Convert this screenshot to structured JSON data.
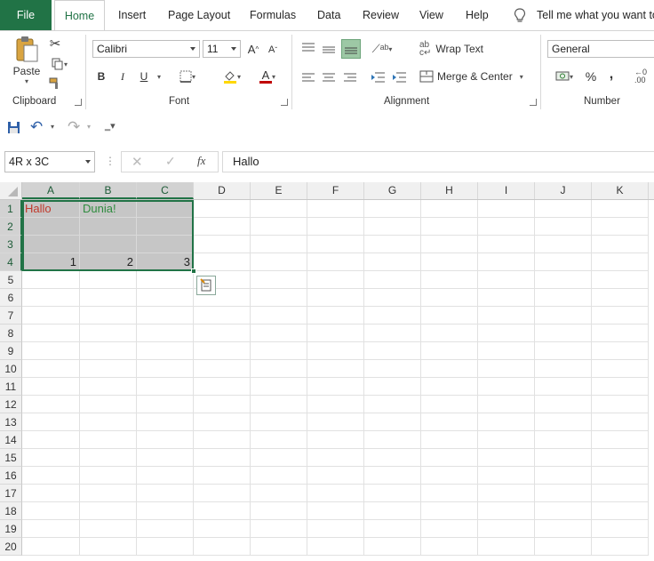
{
  "tabs": {
    "file": "File",
    "home": "Home",
    "insert": "Insert",
    "page_layout": "Page Layout",
    "formulas": "Formulas",
    "data": "Data",
    "review": "Review",
    "view": "View",
    "help": "Help",
    "tell_me": "Tell me what you want to"
  },
  "ribbon": {
    "clipboard": {
      "paste": "Paste",
      "label": "Clipboard"
    },
    "font": {
      "name": "Calibri",
      "size": "11",
      "grow": "A",
      "shrink": "A",
      "bold": "B",
      "italic": "I",
      "underline": "U",
      "font_color": "A",
      "label": "Font"
    },
    "alignment": {
      "wrap_text": "Wrap Text",
      "merge_center": "Merge & Center",
      "label": "Alignment"
    },
    "number": {
      "format": "General",
      "percent": "%",
      "comma": ",",
      "label": "Number"
    }
  },
  "formula_bar": {
    "name_box": "4R x 3C",
    "fx": "fx",
    "content": "Hallo"
  },
  "sheet": {
    "columns": [
      "A",
      "B",
      "C",
      "D",
      "E",
      "F",
      "G",
      "H",
      "I",
      "J",
      "K"
    ],
    "rows": [
      "1",
      "2",
      "3",
      "4",
      "5",
      "6",
      "7",
      "8",
      "9",
      "10",
      "11",
      "12",
      "13",
      "14",
      "15",
      "16",
      "17",
      "18",
      "19",
      "20"
    ],
    "cells": {
      "A1": "Hallo",
      "B1": "Dunia!",
      "A4": "1",
      "B4": "2",
      "C4": "3"
    }
  },
  "colors": {
    "accent": "#217346",
    "selection": "#c6c6c6",
    "hallo_text": "#c0392b",
    "dunia_text": "#2e8b3e"
  }
}
